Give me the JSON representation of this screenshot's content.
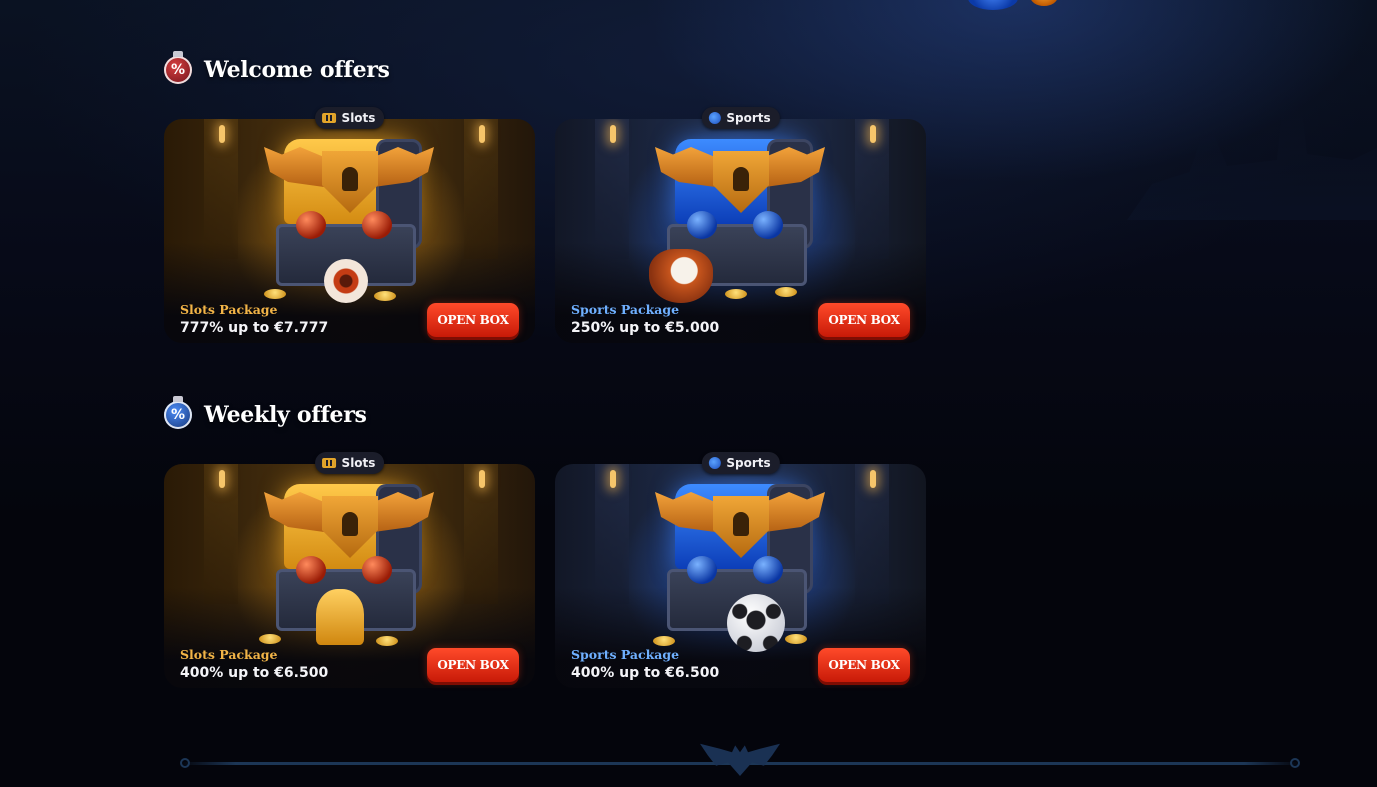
{
  "sections": [
    {
      "title": "Welcome offers",
      "icon": "percent-potion-red-icon",
      "cards": [
        {
          "tag": "Slots",
          "tag_icon": "slot-machine-icon",
          "theme": "slots",
          "package": "Slots Package",
          "amount": "777% up to €7.777",
          "button": "OPEN BOX",
          "prop": "eyeball"
        },
        {
          "tag": "Sports",
          "tag_icon": "sports-ball-icon",
          "theme": "sports",
          "package": "Sports Package",
          "amount": "250% up to €5.000",
          "button": "OPEN BOX",
          "prop": "baseball-glove"
        }
      ]
    },
    {
      "title": "Weekly offers",
      "icon": "percent-potion-blue-icon",
      "cards": [
        {
          "tag": "Slots",
          "tag_icon": "slot-machine-icon",
          "theme": "slots",
          "package": "Slots Package",
          "amount": "400% up to €6.500",
          "button": "OPEN BOX",
          "prop": "bell"
        },
        {
          "tag": "Sports",
          "tag_icon": "sports-ball-icon",
          "theme": "sports",
          "package": "Sports Package",
          "amount": "400% up to €6.500",
          "button": "OPEN BOX",
          "prop": "football"
        }
      ]
    }
  ],
  "colors": {
    "slots_accent": "#f2b447",
    "sports_accent": "#6fb0ff",
    "button_red": "#e02a10",
    "background": "#05060f"
  }
}
